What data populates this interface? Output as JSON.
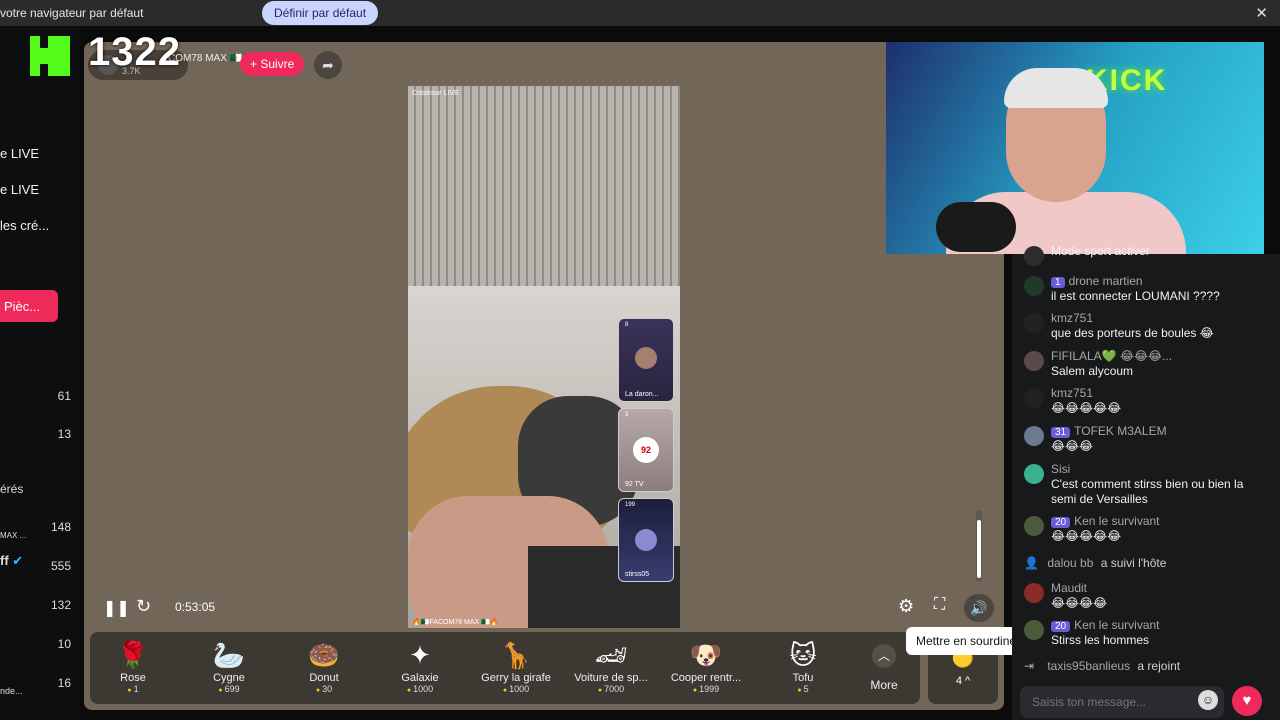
{
  "infobar": {
    "message": "votre navigateur par défaut",
    "button": "Définir par défaut",
    "close": "✕"
  },
  "overlay_count": "1322",
  "sidebar": {
    "links": [
      "e LIVE",
      "e LIVE",
      "les cré..."
    ],
    "button": "Pièc...",
    "numbers": [
      "61",
      "13"
    ],
    "section": "érés",
    "followed": [
      {
        "name": "MAX ...",
        "count": "148"
      },
      {
        "name": "ff",
        "count": "555"
      },
      {
        "name": "",
        "count": "132"
      },
      {
        "name": "",
        "count": "10"
      },
      {
        "name": "nde...",
        "count": "16"
      }
    ]
  },
  "stream": {
    "streamer": "COM78 MAX 🇩🇿🔥",
    "viewers": "3.7K",
    "follow_label": "+ Suivre",
    "watermark_top": "Cntsinsur LIVE",
    "watermark_bottom": "🔥🇩🇿FACOM78 MAX 🇩🇿🔥",
    "time": "0:53:05",
    "thumbs": [
      {
        "count": "8",
        "label": "La daron..."
      },
      {
        "count": "3",
        "label": "92 TV"
      },
      {
        "count": "199",
        "label": "stirss05"
      }
    ],
    "tooltip": "Mettre en sourdine (M)",
    "volume_level": 0.9
  },
  "gifts": [
    {
      "icon": "🌹",
      "name": "Rose",
      "price": "1"
    },
    {
      "icon": "🦢",
      "name": "Cygne",
      "price": "699"
    },
    {
      "icon": "🍩",
      "name": "Donut",
      "price": "30"
    },
    {
      "icon": "✦",
      "name": "Galaxie",
      "price": "1000"
    },
    {
      "icon": "🦒",
      "name": "Gerry la girafe",
      "price": "1000"
    },
    {
      "icon": "🏎",
      "name": "Voiture de sp...",
      "price": "7000"
    },
    {
      "icon": "🐶",
      "name": "Cooper rentr...",
      "price": "1999"
    },
    {
      "icon": "🐱",
      "name": "Tofu",
      "price": "5"
    }
  ],
  "gifts_more": "More",
  "mini_bar_label": "4 ^",
  "webcam": {
    "sign": "KICK"
  },
  "chat": {
    "messages": [
      {
        "user": "",
        "badge": "",
        "text": "Mode sport activer",
        "avatar": "#2d2d2d"
      },
      {
        "user": "drone martien",
        "badge": "1",
        "text": "il est connecter LOUMANI ????",
        "avatar": "#1f3a2a"
      },
      {
        "user": "kmz751",
        "badge": "",
        "text": "que des porteurs de boules 😂",
        "avatar": "#222"
      },
      {
        "user": "FIFILALA💚 😂😂😂...",
        "badge": "",
        "text": "Salem alycoum",
        "avatar": "#5a4a4a"
      },
      {
        "user": "kmz751",
        "badge": "",
        "text": "😂😂😂😂😂",
        "avatar": "#222"
      },
      {
        "user": "TOFEK M3ALEM",
        "badge": "31",
        "text": "😂😂😂",
        "avatar": "#6b7a8f"
      },
      {
        "user": "Sisi",
        "badge": "",
        "text": "C'est comment stirss bien ou bien la semi de Versailles",
        "avatar": "#3bb28f"
      },
      {
        "user": "Ken le survivant",
        "badge": "20",
        "text": "😂😂😂😂😂",
        "avatar": "#4a5a3a"
      },
      {
        "user": "Maudit",
        "badge": "",
        "text": "😂😂😂😂",
        "avatar": "#8a2a2a"
      },
      {
        "user": "Ken le survivant",
        "badge": "20",
        "text": "Stirss les hommes",
        "avatar": "#4a5a3a"
      }
    ],
    "system": [
      {
        "user": "dalou bb",
        "text": "a suivi l'hôte"
      },
      {
        "user": "taxis95banlieus",
        "text": "a rejoint"
      }
    ],
    "input_placeholder": "Saisis ton message..."
  },
  "colors": {
    "accent": "#ee2a5a",
    "kick_green": "#53fc18",
    "stage": "#716657"
  }
}
